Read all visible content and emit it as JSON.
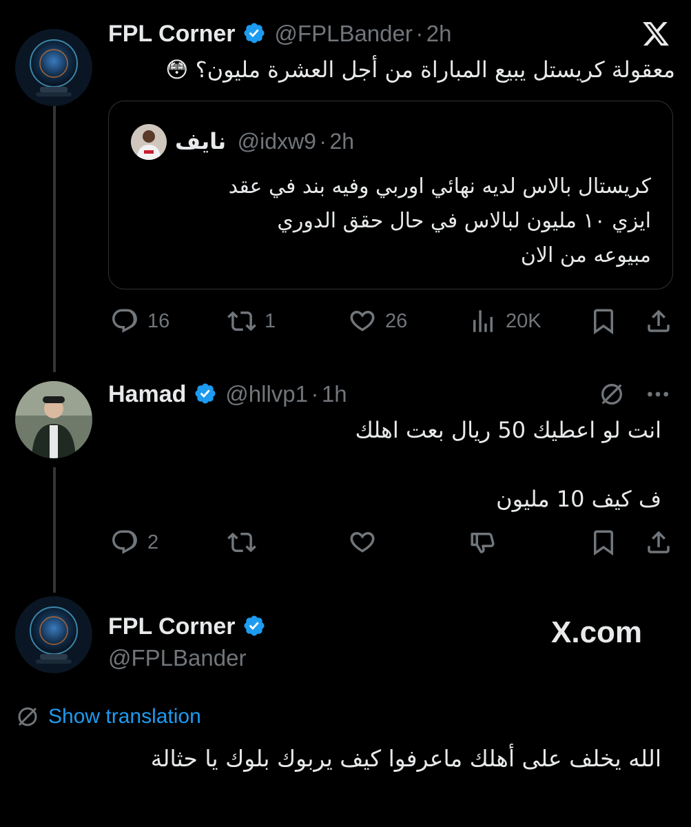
{
  "tweet1": {
    "name": "FPL Corner",
    "handle": "@FPLBander",
    "time": "2h",
    "text": "معقولة كريستل يبيع المباراة من أجل العشرة مليون؟",
    "emoji": "😳",
    "quote": {
      "name": "نايف",
      "handle": "@idxw9",
      "time": "2h",
      "lines": [
        "كريستال بالاس لديه نهائي اوربي وفيه بند في عقد",
        "ايزي ١٠ مليون لبالاس في حال حقق الدوري",
        "مبيوعه من الان"
      ]
    },
    "stats": {
      "replies": "16",
      "reposts": "1",
      "likes": "26",
      "views": "20K"
    }
  },
  "tweet2": {
    "name": "Hamad",
    "handle": "@hllvp1",
    "time": "1h",
    "line1": "انت لو اعطيك 50 ريال بعت اهلك",
    "line2": "ف كيف 10 مليون",
    "stats": {
      "replies": "2"
    }
  },
  "tweet3": {
    "name": "FPL Corner",
    "handle": "@FPLBander",
    "brand": "X.com",
    "translate_label": "Show translation",
    "text": "الله يخلف على أهلك ماعرفوا كيف يربوك بلوك يا حثالة"
  },
  "colors": {
    "background": "#000000",
    "text": "#e7e9ea",
    "muted": "#71767b",
    "accent": "#1d9bf0",
    "border": "#2f3336"
  },
  "icons": [
    "x-logo-icon",
    "verified-icon",
    "reply-icon",
    "repost-icon",
    "like-icon",
    "views-icon",
    "bookmark-icon",
    "share-icon",
    "translate-icon",
    "more-icon",
    "dislike-icon"
  ]
}
